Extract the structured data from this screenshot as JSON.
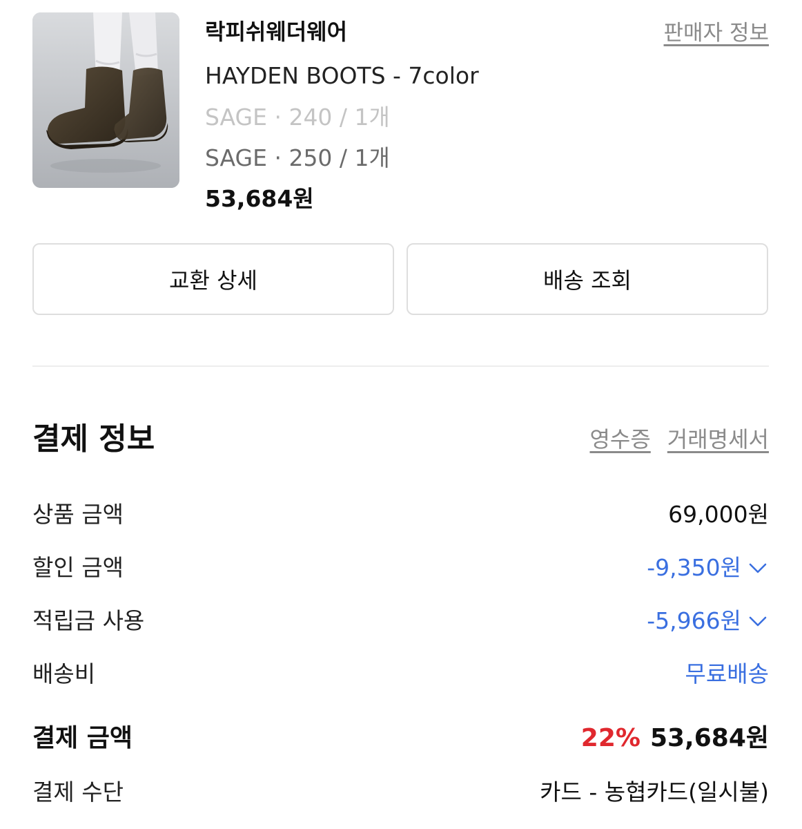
{
  "product": {
    "seller_name": "락피쉬웨더웨어",
    "seller_info_link": "판매자 정보",
    "name": "HAYDEN BOOTS - 7color",
    "options": [
      {
        "text": "SAGE · 240 / 1개",
        "state": "muted"
      },
      {
        "text": "SAGE · 250 / 1개",
        "state": "active"
      }
    ],
    "price": "53,684원",
    "image_icon": "boots-photo"
  },
  "actions": {
    "exchange_detail": "교환 상세",
    "track_delivery": "배송 조회"
  },
  "payment": {
    "title": "결제 정보",
    "receipt_link": "영수증",
    "statement_link": "거래명세서",
    "rows": {
      "product_amount": {
        "label": "상품 금액",
        "value": "69,000원"
      },
      "discount_amount": {
        "label": "할인 금액",
        "value": "-9,350원",
        "icon": "chevron-down-icon"
      },
      "points_used": {
        "label": "적립금 사용",
        "value": "-5,966원",
        "icon": "chevron-down-icon"
      },
      "shipping_fee": {
        "label": "배송비",
        "value": "무료배송"
      },
      "total": {
        "label": "결제 금액",
        "rate": "22%",
        "value": "53,684원"
      },
      "method": {
        "label": "결제 수단",
        "value": "카드 - 농협카드(일시불)"
      }
    }
  },
  "colors": {
    "accent_blue": "#3a6fe0",
    "discount_red": "#e0282e",
    "muted_gray": "#8a8a8a"
  }
}
